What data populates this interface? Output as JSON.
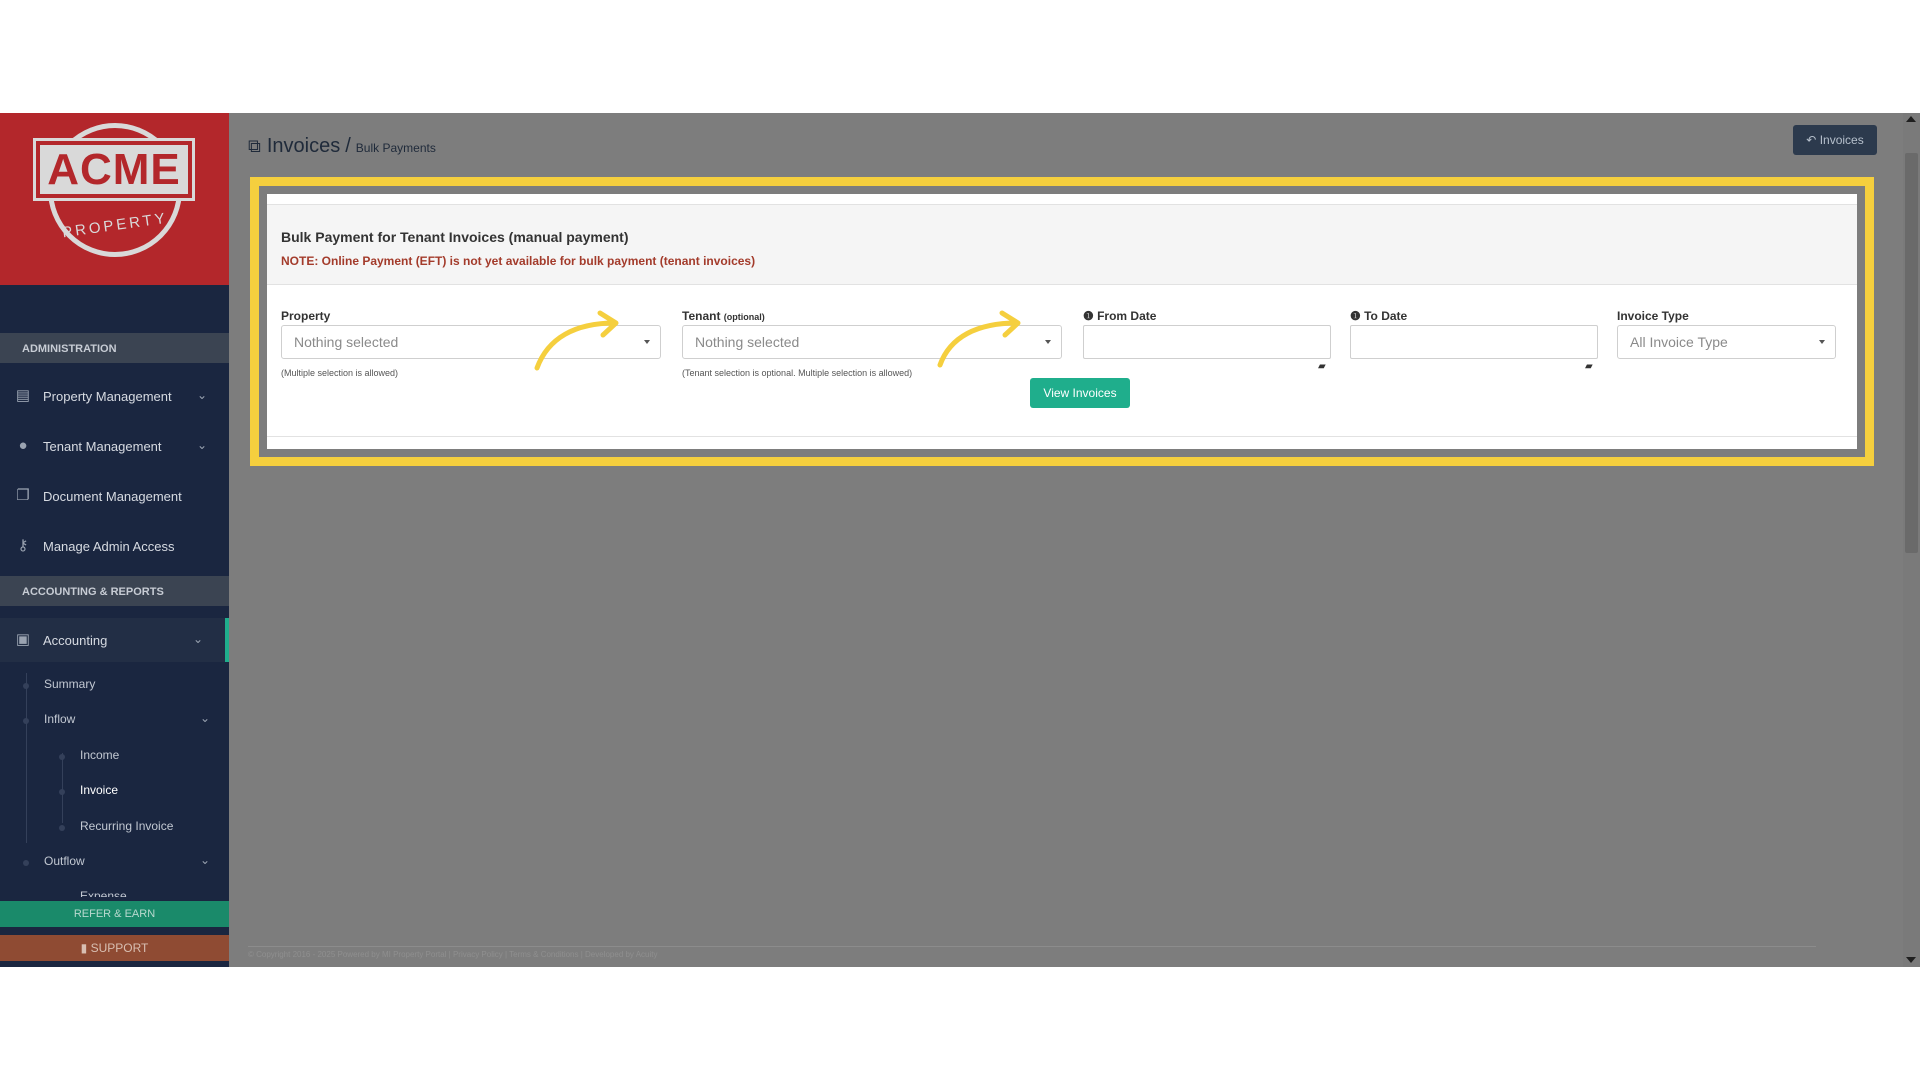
{
  "logo": {
    "name": "ACME",
    "tagline": "PROPERTY"
  },
  "sidebar": {
    "sections": [
      {
        "label": "ADMINISTRATION"
      },
      {
        "label": "ACCOUNTING & REPORTS"
      }
    ],
    "admin_items": [
      {
        "label": "Property Management",
        "icon": "building-icon"
      },
      {
        "label": "Tenant Management",
        "icon": "users-icon"
      },
      {
        "label": "Document Management",
        "icon": "documents-icon"
      },
      {
        "label": "Manage Admin Access",
        "icon": "key-icon"
      }
    ],
    "accounting": {
      "label": "Accounting",
      "icon": "money-icon"
    },
    "sub_items": {
      "summary": "Summary",
      "inflow": "Inflow",
      "income": "Income",
      "invoice": "Invoice",
      "recurring_invoice": "Recurring Invoice",
      "outflow": "Outflow",
      "expense": "Expense"
    },
    "refer_label": "REFER & EARN",
    "support_label": "SUPPORT"
  },
  "header": {
    "title": "Invoices",
    "separator": "/",
    "subtitle": "Bulk Payments",
    "back_button": "Invoices"
  },
  "card": {
    "title": "Bulk Payment for Tenant Invoices (manual payment)",
    "note": "NOTE: Online Payment (EFT) is not yet available for bulk payment (tenant invoices)"
  },
  "form": {
    "property": {
      "label": "Property",
      "value": "Nothing selected",
      "help": "(Multiple selection is allowed)"
    },
    "tenant": {
      "label": "Tenant",
      "label_suffix": "(optional)",
      "value": "Nothing selected",
      "help": "(Tenant selection is optional. Multiple selection is allowed)"
    },
    "from_date": {
      "label": "From Date",
      "value": ""
    },
    "to_date": {
      "label": "To Date",
      "value": ""
    },
    "invoice_type": {
      "label": "Invoice Type",
      "value": "All Invoice Type"
    },
    "submit_label": "View Invoices"
  },
  "footer": {
    "text": "© Copyright 2016 - 2025 Powered by MI Property Portal | Privacy Policy | Terms & Conditions | Developed by Acuity"
  },
  "colors": {
    "accent": "#1fae8c",
    "highlight": "#f5cf3e",
    "note_red": "#a33b2b",
    "sidebar_bg": "#1a2640",
    "brand_red": "#b3272b"
  }
}
